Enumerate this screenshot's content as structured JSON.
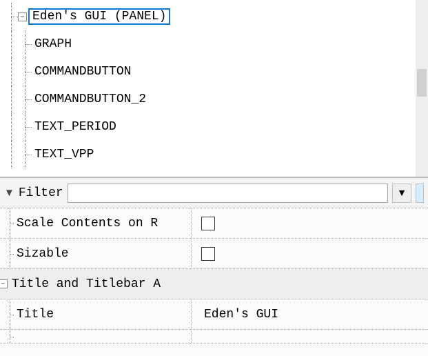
{
  "tree": {
    "rootLabel": "Eden's GUI (PANEL)",
    "children": [
      "GRAPH",
      "COMMANDBUTTON",
      "COMMANDBUTTON_2",
      "TEXT_PERIOD",
      "TEXT_VPP"
    ]
  },
  "filter": {
    "label": "Filter",
    "value": ""
  },
  "props": {
    "scaleContents": {
      "label": "Scale Contents on R",
      "checked": false
    },
    "sizable": {
      "label": "Sizable",
      "checked": false
    },
    "titleGroup": {
      "label": "Title and Titlebar A"
    },
    "title": {
      "label": "Title",
      "value": "Eden's GUI"
    }
  }
}
